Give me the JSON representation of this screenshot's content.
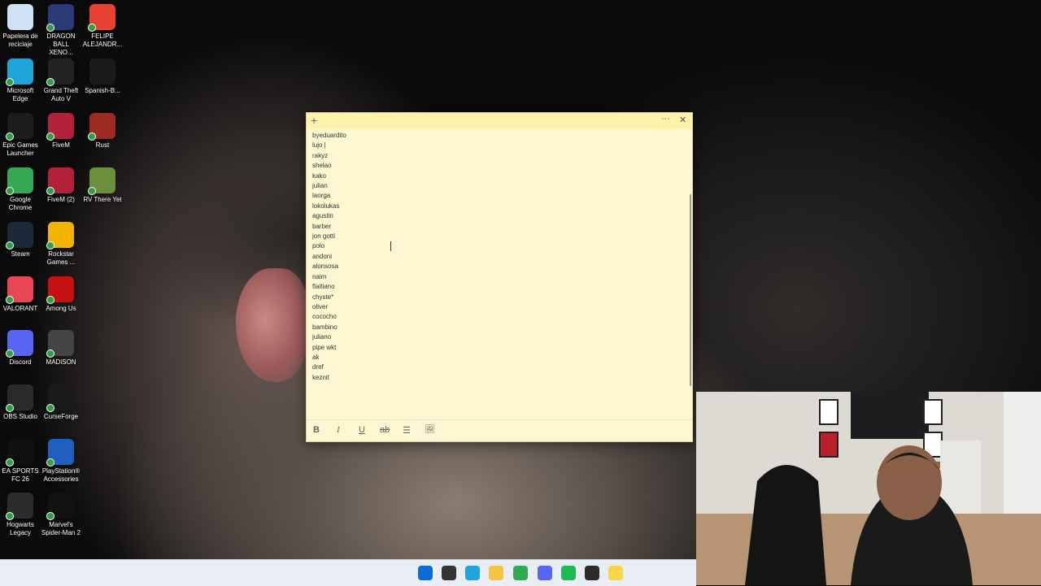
{
  "desktop": {
    "icons": [
      {
        "label": "Papelera de reciclaje",
        "icon": "recycle-bin-icon",
        "color": "#cfe3f5"
      },
      {
        "label": "DRAGON BALL XENO...",
        "icon": "dragon-ball-icon",
        "color": "#2a3b78"
      },
      {
        "label": "FELIPE ALEJANDR...",
        "icon": "chrome-profile-icon",
        "color": "#e94235"
      },
      {
        "label": "Microsoft Edge",
        "icon": "edge-icon",
        "color": "#1fa3d8"
      },
      {
        "label": "Grand Theft Auto V",
        "icon": "gta-icon",
        "color": "#222222"
      },
      {
        "label": "Spanish-B...",
        "icon": "folder-icon",
        "color": "#1a1a1a"
      },
      {
        "label": "Epic Games Launcher",
        "icon": "epic-games-icon",
        "color": "#1c1c1c"
      },
      {
        "label": "FiveM",
        "icon": "fivem-icon",
        "color": "#b3203a"
      },
      {
        "label": "Rust",
        "icon": "rust-icon",
        "color": "#9d2b24"
      },
      {
        "label": "Google Chrome",
        "icon": "chrome-icon",
        "color": "#34a853"
      },
      {
        "label": "FiveM (2)",
        "icon": "fivem-icon",
        "color": "#b3203a"
      },
      {
        "label": "RV There Yet",
        "icon": "rv-there-yet-icon",
        "color": "#6b8f3a"
      },
      {
        "label": "Steam",
        "icon": "steam-icon",
        "color": "#1b2838"
      },
      {
        "label": "Rockstar Games ...",
        "icon": "rockstar-icon",
        "color": "#f2b300"
      },
      {
        "label": "VALORANT",
        "icon": "valorant-icon",
        "color": "#e84654"
      },
      {
        "label": "Among Us",
        "icon": "among-us-icon",
        "color": "#c51111"
      },
      {
        "label": "Discord",
        "icon": "discord-icon",
        "color": "#5865f2"
      },
      {
        "label": "MADiSON",
        "icon": "madison-icon",
        "color": "#444444"
      },
      {
        "label": "OBS Studio",
        "icon": "obs-icon",
        "color": "#2b2b2b"
      },
      {
        "label": "CurseForge",
        "icon": "curseforge-icon",
        "color": "#1a1a1a"
      },
      {
        "label": "EA SPORTS FC 26",
        "icon": "fc26-icon",
        "color": "#101010"
      },
      {
        "label": "PlayStation® Accessories",
        "icon": "playstation-icon",
        "color": "#1f5fbf"
      },
      {
        "label": "Hogwarts Legacy",
        "icon": "hogwarts-icon",
        "color": "#2c2c2c"
      },
      {
        "label": "Marvel's Spider-Man 2",
        "icon": "spiderman-icon",
        "color": "#111111"
      }
    ]
  },
  "sticky_note": {
    "add_label": "+",
    "menu_label": "···",
    "close_label": "✕",
    "lines": [
      "byeduardito",
      "lujo |",
      "rakyz",
      "shelao",
      "kako",
      "julian",
      "laorga",
      "lokolukas",
      "agustin",
      "barber",
      "jon gotti",
      "polo",
      "andoni",
      "alonsosa",
      "naim",
      "flaitiano",
      "chyste*",
      "oliver",
      "cococho",
      "bambino",
      "juliano",
      "pipe wkt",
      "ak",
      "dref",
      "keznit"
    ],
    "toolbar": {
      "bold": "B",
      "italic": "I",
      "underline": "U",
      "strike": "ab",
      "list": "☰",
      "image": "🖼"
    }
  },
  "taskbar": {
    "icons": [
      {
        "icon": "windows-start-icon",
        "color": "#0a6cd6"
      },
      {
        "icon": "search-icon",
        "color": "#333333"
      },
      {
        "icon": "edge-icon",
        "color": "#1fa3d8"
      },
      {
        "icon": "file-explorer-icon",
        "color": "#f4c542"
      },
      {
        "icon": "chrome-icon",
        "color": "#34a853"
      },
      {
        "icon": "discord-icon",
        "color": "#5865f2"
      },
      {
        "icon": "spotify-icon",
        "color": "#1db954"
      },
      {
        "icon": "obs-icon",
        "color": "#2b2b2b"
      },
      {
        "icon": "sticky-notes-icon",
        "color": "#f7d64b"
      }
    ]
  }
}
